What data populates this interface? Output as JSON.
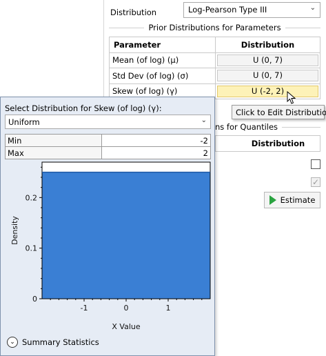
{
  "main": {
    "distribution_label": "Distribution",
    "distribution_value": "Log-Pearson Type III",
    "prior_group_title": "Prior Distributions for Parameters",
    "table": {
      "headers": [
        "Parameter",
        "Distribution"
      ],
      "rows": [
        {
          "name": "Mean (of log) (μ)",
          "dist": "U (0, 7)"
        },
        {
          "name": "Std Dev (of log) (σ)",
          "dist": "U (0, 7)"
        },
        {
          "name": "Skew (of log) (γ)",
          "dist": "U (-2, 2)"
        }
      ]
    },
    "tooltip": "Click to Edit Distribution",
    "quantile_group_title": "ns for Quantiles",
    "quantile_header": "Distribution",
    "estimate_label": "Estimate",
    "check1_checked": false,
    "check2_checked": true
  },
  "popup": {
    "title": "Select Distribution for Skew (of log) (γ):",
    "dist_value": "Uniform",
    "params": [
      {
        "name": "Min",
        "value": "-2"
      },
      {
        "name": "Max",
        "value": "2"
      }
    ],
    "summary_label": "Summary Statistics"
  },
  "colors": {
    "fill": "#3a7fd4",
    "highlight": "#fdf2b8",
    "estimate_icon": "#2aa340"
  },
  "chart_data": {
    "type": "area",
    "xlabel": "X Value",
    "ylabel": "Density",
    "x": [
      -2,
      2
    ],
    "values": [
      0.25,
      0.25
    ],
    "xlim": [
      -2,
      2
    ],
    "ylim": [
      0,
      0.27
    ],
    "xticks": [
      -1,
      0,
      1
    ],
    "yticks": [
      0,
      0.1,
      0.2
    ],
    "grid": false
  }
}
